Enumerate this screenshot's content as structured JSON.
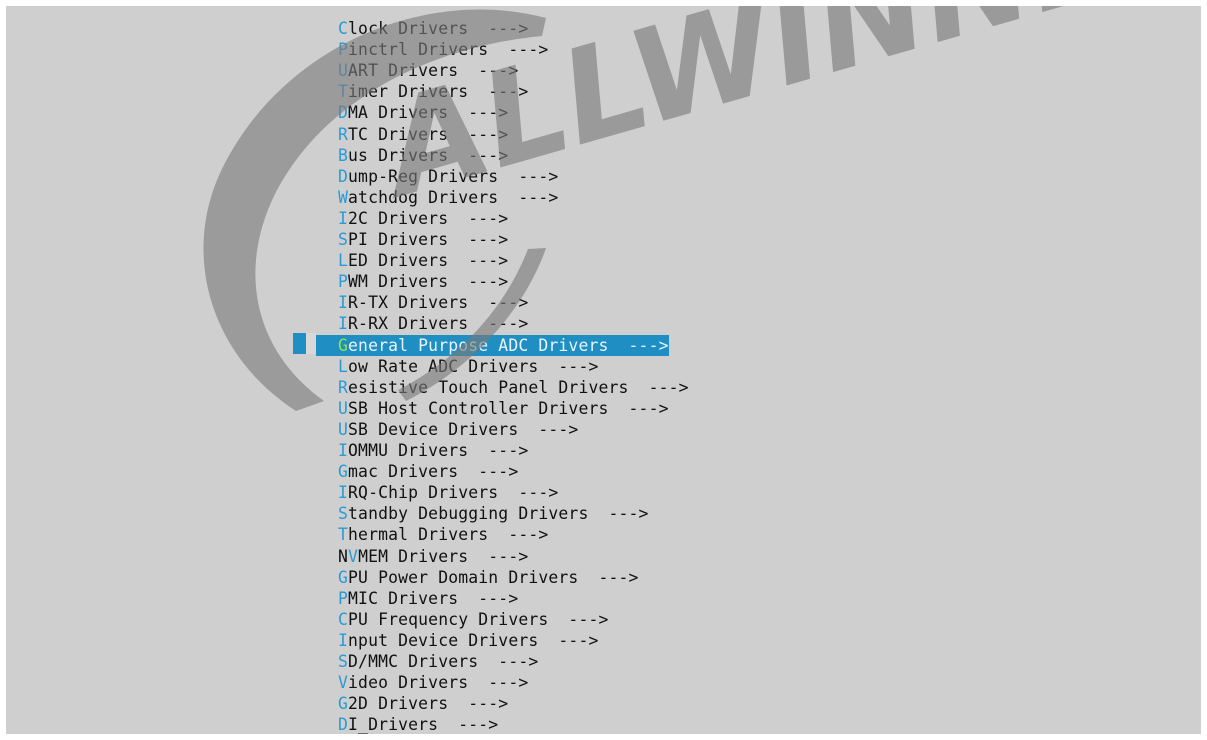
{
  "watermark": {
    "text": "ALLWINNER",
    "color": "#7a7a7a"
  },
  "colors": {
    "background": "#cfcfcf",
    "text": "#111111",
    "hotkey": "#2a9bd6",
    "selection": "#1e8ec3",
    "selected_hotkey": "#8fe34a"
  },
  "menu": {
    "selected_index": 15,
    "items": [
      {
        "hotkey": "C",
        "rest": "lock Drivers  --->"
      },
      {
        "hotkey": "P",
        "rest": "inctrl Drivers  --->"
      },
      {
        "hotkey": "U",
        "rest": "ART Drivers  --->"
      },
      {
        "hotkey": "T",
        "rest": "imer Drivers  --->"
      },
      {
        "hotkey": "D",
        "rest": "MA Drivers  --->"
      },
      {
        "hotkey": "R",
        "rest": "TC Drivers  --->"
      },
      {
        "hotkey": "B",
        "rest": "us Drivers  --->"
      },
      {
        "hotkey": "D",
        "rest": "ump-Reg Drivers  --->"
      },
      {
        "hotkey": "W",
        "rest": "atchdog Drivers  --->"
      },
      {
        "hotkey": "I",
        "rest": "2C Drivers  --->"
      },
      {
        "hotkey": "S",
        "rest": "PI Drivers  --->"
      },
      {
        "hotkey": "L",
        "rest": "ED Drivers  --->"
      },
      {
        "hotkey": "P",
        "rest": "WM Drivers  --->"
      },
      {
        "hotkey": "I",
        "rest": "R-TX Drivers  --->"
      },
      {
        "hotkey": "I",
        "rest": "R-RX Drivers  --->"
      },
      {
        "hotkey": "G",
        "rest": "eneral Purpose ADC Drivers  --->"
      },
      {
        "hotkey": "L",
        "rest": "ow Rate ADC Drivers  --->"
      },
      {
        "hotkey": "R",
        "rest": "esistive Touch Panel Drivers  --->"
      },
      {
        "hotkey": "U",
        "rest": "SB Host Controller Drivers  --->"
      },
      {
        "hotkey": "U",
        "rest": "SB Device Drivers  --->"
      },
      {
        "hotkey": "I",
        "rest": "OMMU Drivers  --->"
      },
      {
        "hotkey": "G",
        "rest": "mac Drivers  --->"
      },
      {
        "hotkey": "I",
        "rest": "RQ-Chip Drivers  --->"
      },
      {
        "hotkey": "S",
        "rest": "tandby Debugging Drivers  --->"
      },
      {
        "hotkey": "T",
        "rest": "hermal Drivers  --->"
      },
      {
        "prefix": "N",
        "hotkey": "V",
        "rest": "MEM Drivers  --->"
      },
      {
        "hotkey": "G",
        "rest": "PU Power Domain Drivers  --->"
      },
      {
        "hotkey": "P",
        "rest": "MIC Drivers  --->"
      },
      {
        "hotkey": "C",
        "rest": "PU Frequency Drivers  --->"
      },
      {
        "hotkey": "I",
        "rest": "nput Device Drivers  --->"
      },
      {
        "hotkey": "S",
        "rest": "D/MMC Drivers  --->"
      },
      {
        "hotkey": "V",
        "rest": "ideo Drivers  --->"
      },
      {
        "hotkey": "G",
        "rest": "2D Drivers  --->"
      },
      {
        "hotkey": "D",
        "rest": "I_Drivers  --->"
      }
    ]
  }
}
